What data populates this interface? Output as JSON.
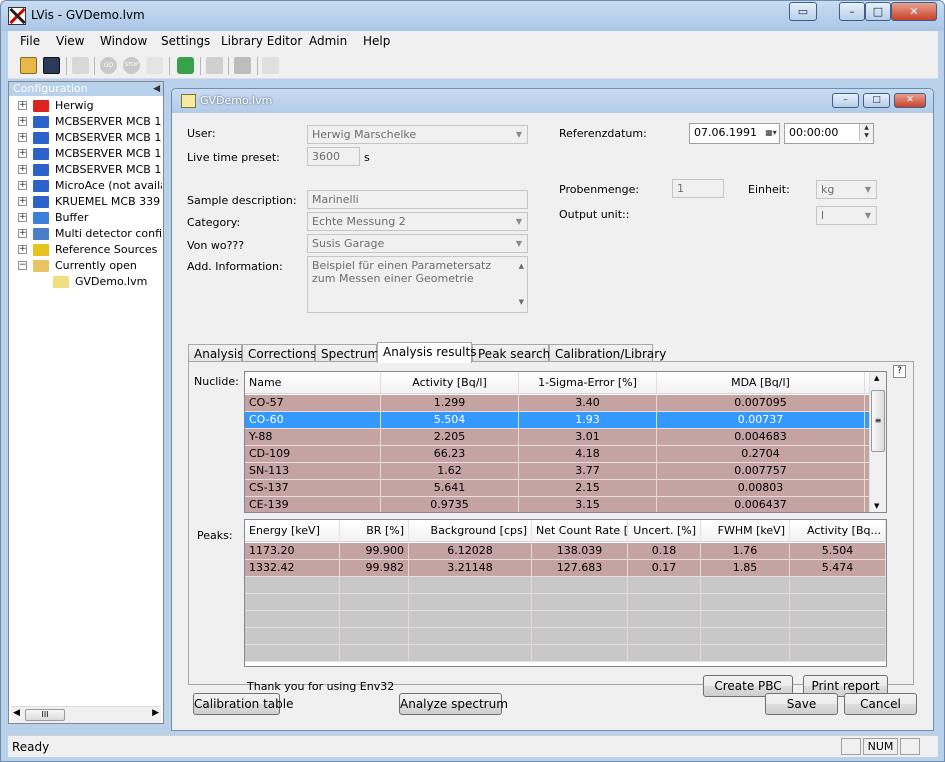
{
  "window": {
    "title": "LVis - GVDemo.lvm"
  },
  "menu": [
    "File",
    "View",
    "Window",
    "Settings",
    "Library Editor",
    "Admin",
    "Help"
  ],
  "toolbar": {
    "icons": [
      "open-folder-icon",
      "save-icon",
      "network-icon",
      "go-icon",
      "stop-icon",
      "wand-icon",
      "lock-icon",
      "device-icon",
      "monitor-icon",
      "bolt-icon"
    ],
    "go_label": "GO",
    "stop_label": "STOP"
  },
  "config": {
    "header": "Configuration",
    "items": [
      {
        "label": "Herwig",
        "icon": "detector-red-icon"
      },
      {
        "label": "MCBSERVER MCB 1",
        "icon": "mcb-icon"
      },
      {
        "label": "MCBSERVER MCB 1",
        "icon": "mcb-icon"
      },
      {
        "label": "MCBSERVER MCB 1",
        "icon": "mcb-icon"
      },
      {
        "label": "MCBSERVER MCB 1",
        "icon": "mcb-icon"
      },
      {
        "label": "MicroAce (not availab",
        "icon": "mcb-icon"
      },
      {
        "label": "KRUEMEL MCB 339 |",
        "icon": "mcb-icon"
      },
      {
        "label": "Buffer",
        "icon": "buffer-icon"
      },
      {
        "label": "Multi detector configu",
        "icon": "multi-detector-icon"
      },
      {
        "label": "Reference Sources",
        "icon": "radiation-icon"
      },
      {
        "label": "Currently open",
        "icon": "folder-open-icon"
      },
      {
        "label": "GVDemo.lvm",
        "icon": "lvm-file-icon"
      }
    ]
  },
  "status": {
    "text": "Ready",
    "num": "NUM"
  },
  "child": {
    "title": "GVDemo.lvm",
    "user_label": "User:",
    "user_value": "Herwig Marschelke",
    "live_label": "Live time preset:",
    "live_value": "3600",
    "live_unit": "s",
    "ref_label": "Referenzdatum:",
    "ref_date": "07.06.1991",
    "ref_time": "00:00:00",
    "sample_label": "Sample description:",
    "sample_value": "Marinelli",
    "category_label": "Category:",
    "category_value": "Echte Messung 2",
    "vonwo_label": "Von wo???",
    "vonwo_value": "Susis Garage",
    "addinfo_label": "Add. Information:",
    "addinfo_value": "Beispiel für einen Parametersatz zum Messen einer Geometrie",
    "probenmenge_label": "Probenmenge:",
    "probenmenge_value": "1",
    "einheit_label": "Einheit:",
    "einheit_value": "kg",
    "output_label": "Output unit::",
    "output_value": "l"
  },
  "tabs": [
    "Analysis",
    "Corrections",
    "Spectrum",
    "Analysis results",
    "Peak search",
    "Calibration/Library"
  ],
  "active_tab": 3,
  "nuclide": {
    "label": "Nuclide:",
    "columns": [
      "Name",
      "Activity [Bq/l]",
      "1-Sigma-Error [%]",
      "MDA [Bq/l]"
    ],
    "rows": [
      [
        "CO-57",
        "1.299",
        "3.40",
        "0.007095"
      ],
      [
        "CO-60",
        "5.504",
        "1.93",
        "0.00737"
      ],
      [
        "Y-88",
        "2.205",
        "3.01",
        "0.004683"
      ],
      [
        "CD-109",
        "66.23",
        "4.18",
        "0.2704"
      ],
      [
        "SN-113",
        "1.62",
        "3.77",
        "0.007757"
      ],
      [
        "CS-137",
        "5.641",
        "2.15",
        "0.00803"
      ],
      [
        "CE-139",
        "0.9735",
        "3.15",
        "0.006437"
      ]
    ],
    "selected": 1
  },
  "peaks": {
    "label": "Peaks:",
    "columns": [
      "Energy [keV]",
      "BR [%]",
      "Background [cps]",
      "Net Count Rate [...",
      "Uncert. [%]",
      "FWHM [keV]",
      "Activity [Bq..."
    ],
    "rows": [
      [
        "1173.20",
        "99.900",
        "6.12028",
        "138.039",
        "0.18",
        "1.76",
        "5.504"
      ],
      [
        "1332.42",
        "99.982",
        "3.21148",
        "127.683",
        "0.17",
        "1.85",
        "5.474"
      ]
    ]
  },
  "panel": {
    "thanks": "Thank you for using Env32",
    "create_pbc": "Create PBC",
    "print_report": "Print report",
    "help": "?"
  },
  "footer": {
    "calibration_table": "Calibration table",
    "analyze_spectrum": "Analyze spectrum",
    "save": "Save",
    "cancel": "Cancel"
  }
}
